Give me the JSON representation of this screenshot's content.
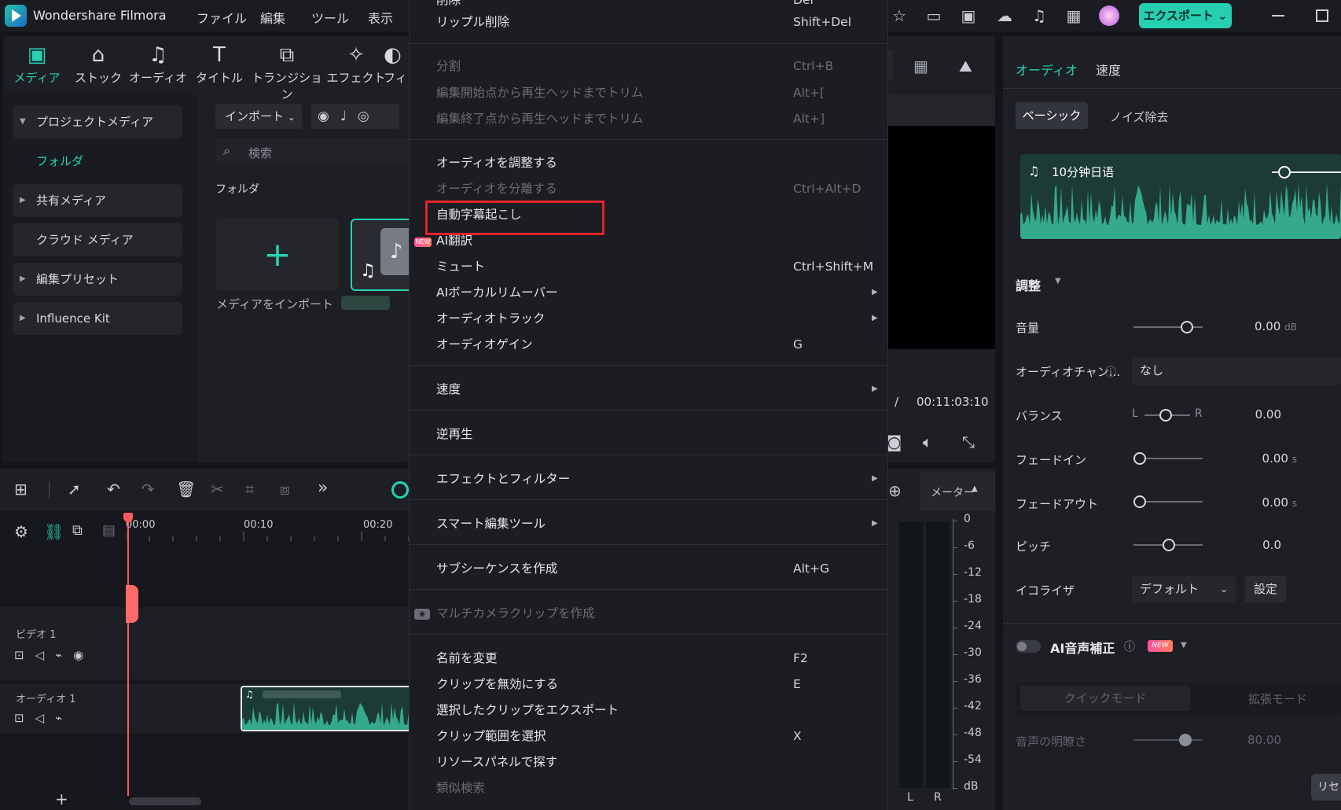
{
  "titlebar": {
    "app_title": "Wondershare Filmora",
    "menus": [
      "ファイル",
      "編集",
      "ツール",
      "表示"
    ],
    "export_label": "エクスポート",
    "export_chevron": "chevron-down-icon"
  },
  "toolbar": {
    "items": [
      "メディア",
      "ストック",
      "オーディオ",
      "タイトル",
      "トランジション",
      "エフェクト",
      "フィ"
    ]
  },
  "sidebar": {
    "items": [
      "プロジェクトメディア",
      "フォルダ",
      "共有メディア",
      "クラウド メディア",
      "編集プリセット",
      "Influence Kit"
    ]
  },
  "media": {
    "import_label": "インポート",
    "search_placeholder": "検索",
    "folder_label": "フォルダ",
    "import_media_label": "メディアをインポート"
  },
  "context_menu": {
    "top_cut_label": "削除",
    "top_cut_shortcut": "Del",
    "items": [
      {
        "label": "リップル削除",
        "shortcut": "Shift+Del",
        "disabled": false
      },
      {
        "label": "分割",
        "shortcut": "Ctrl+B",
        "disabled": true
      },
      {
        "label": "編集開始点から再生ヘッドまでトリム",
        "shortcut": "Alt+[",
        "disabled": true
      },
      {
        "label": "編集終了点から再生ヘッドまでトリム",
        "shortcut": "Alt+]",
        "disabled": true
      },
      {
        "label": "オーディオを調整する",
        "shortcut": "",
        "disabled": false
      },
      {
        "label": "オーディオを分離する",
        "shortcut": "Ctrl+Alt+D",
        "disabled": true
      },
      {
        "label": "自動字幕起こし",
        "shortcut": "",
        "disabled": false
      },
      {
        "label": "AI翻訳",
        "shortcut": "",
        "disabled": false
      },
      {
        "label": "ミュート",
        "shortcut": "Ctrl+Shift+M",
        "disabled": false
      },
      {
        "label": "AIボーカルリムーバー",
        "shortcut": "",
        "disabled": false
      },
      {
        "label": "オーディオトラック",
        "shortcut": "",
        "disabled": false
      },
      {
        "label": "オーディオゲイン",
        "shortcut": "G",
        "disabled": false
      },
      {
        "label": "速度",
        "shortcut": "",
        "disabled": false
      },
      {
        "label": "逆再生",
        "shortcut": "",
        "disabled": false
      },
      {
        "label": "エフェクトとフィルター",
        "shortcut": "",
        "disabled": false
      },
      {
        "label": "スマート編集ツール",
        "shortcut": "",
        "disabled": false
      },
      {
        "label": "サブシーケンスを作成",
        "shortcut": "Alt+G",
        "disabled": false
      },
      {
        "label": "マルチカメラクリップを作成",
        "shortcut": "",
        "disabled": true
      },
      {
        "label": "名前を変更",
        "shortcut": "F2",
        "disabled": false
      },
      {
        "label": "クリップを無効にする",
        "shortcut": "E",
        "disabled": false
      },
      {
        "label": "選択したクリップをエクスポート",
        "shortcut": "",
        "disabled": false
      },
      {
        "label": "クリップ範囲を選択",
        "shortcut": "X",
        "disabled": false
      },
      {
        "label": "リソースパネルで探す",
        "shortcut": "",
        "disabled": false
      },
      {
        "label": "類似検索",
        "shortcut": "",
        "disabled": true
      }
    ],
    "new_badge": "NEW"
  },
  "player": {
    "total_time": "00:11:03:10",
    "separator": "/"
  },
  "right_panel": {
    "tabs": [
      "オーディオ",
      "速度"
    ],
    "subtabs": [
      "ベーシック",
      "ノイズ除去"
    ],
    "clip_name": "10分钟日语",
    "section_adjust": "調整",
    "volume_label": "音量",
    "volume_value": "0.00",
    "volume_unit": "dB",
    "channel_label": "オーディオチャン...",
    "channel_value": "なし",
    "balance_label": "バランス",
    "balance_l": "L",
    "balance_r": "R",
    "balance_value": "0.00",
    "fadein_label": "フェードイン",
    "fadein_value": "0.00",
    "fadein_unit": "s",
    "fadeout_label": "フェードアウト",
    "fadeout_value": "0.00",
    "fadeout_unit": "s",
    "pitch_label": "ピッチ",
    "pitch_value": "0.0",
    "eq_label": "イコライザ",
    "eq_value": "デフォルト",
    "eq_button": "設定",
    "ai_voice_label": "AI音声補正",
    "ai_voice_badge": "NEW",
    "quick_mode": "クイックモード",
    "extended_mode": "拡張モード",
    "clarity_label": "音声の明瞭さ",
    "clarity_value": "80.00",
    "reset_label": "リセ"
  },
  "timeline": {
    "ruler": [
      "00:00",
      "00:10",
      "00:20"
    ],
    "video_track": "ビデオ 1",
    "audio_track": "オーディオ 1",
    "meter_label": "メーター",
    "meter_scale": [
      "0",
      "-6",
      "-12",
      "-18",
      "-24",
      "-30",
      "-36",
      "-42",
      "-48",
      "-54",
      "dB"
    ],
    "meter_l": "L",
    "meter_r": "R"
  },
  "colors": {
    "accent": "#27d3b2",
    "highlight_box": "#e4232c"
  }
}
